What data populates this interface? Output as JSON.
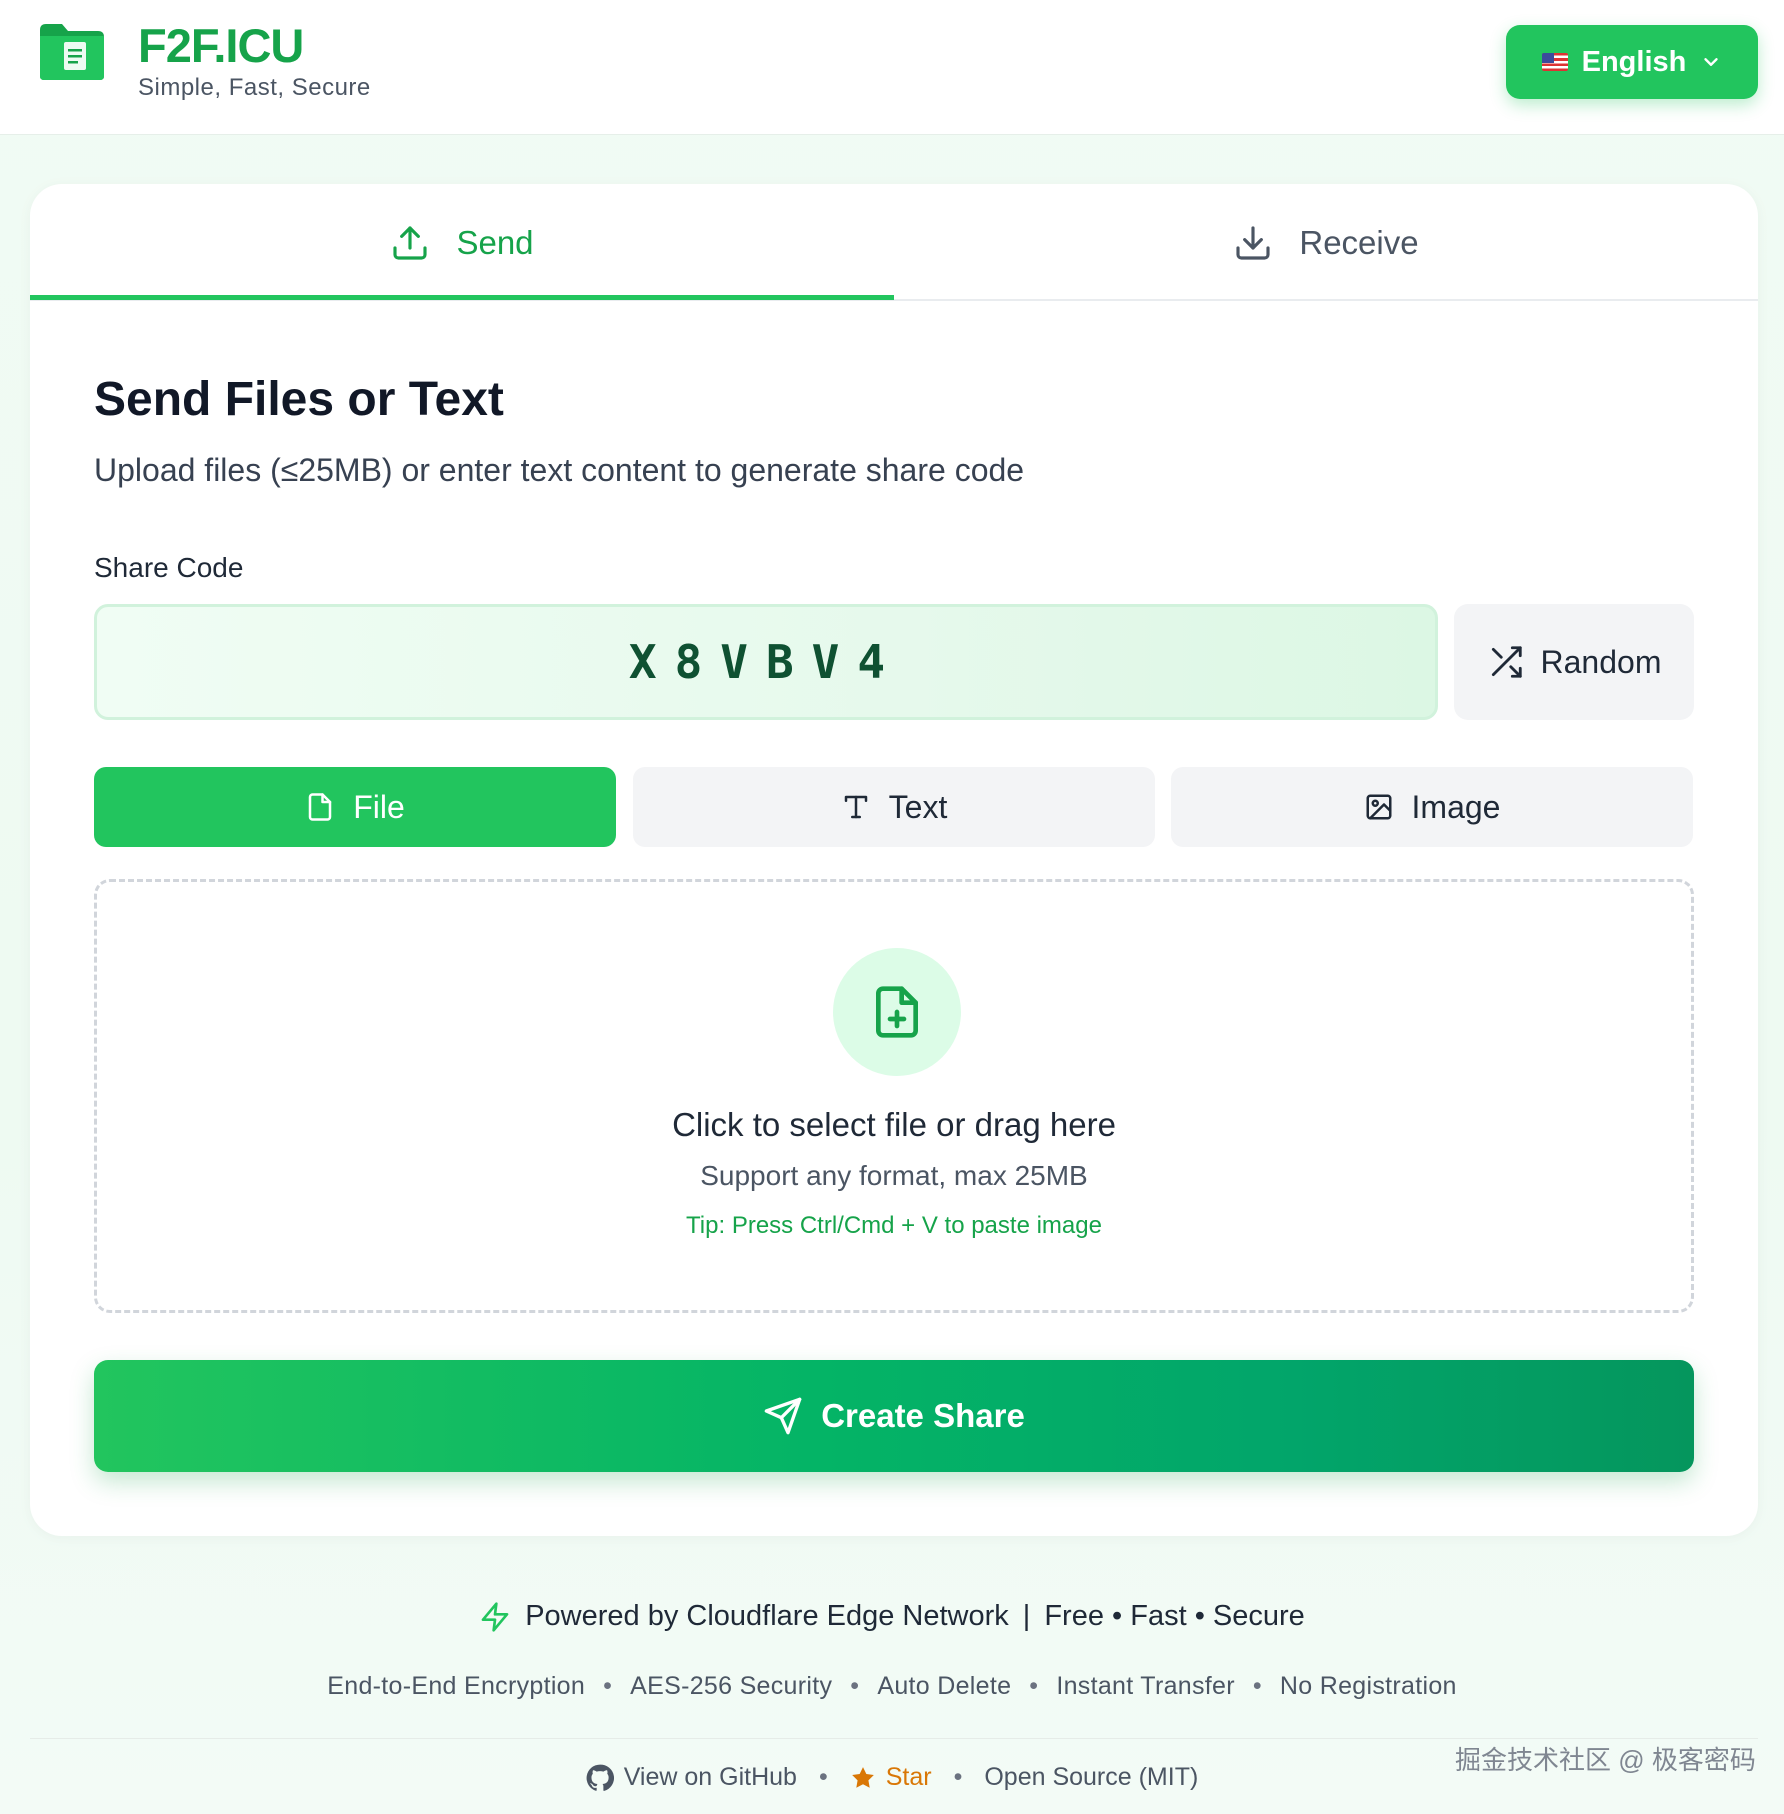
{
  "header": {
    "brand_name": "F2F.ICU",
    "tagline": "Simple, Fast, Secure",
    "language_label": "English",
    "language_flag": "us-flag-icon"
  },
  "tabs": [
    {
      "label": "Send",
      "icon": "upload-icon",
      "active": true
    },
    {
      "label": "Receive",
      "icon": "download-icon",
      "active": false
    }
  ],
  "send": {
    "title": "Send Files or Text",
    "subtitle": "Upload files (≤25MB) or enter text content to generate share code",
    "share_code_label": "Share Code",
    "share_code_value": "X8VBV4",
    "random_label": "Random",
    "modes": [
      {
        "label": "File",
        "icon": "file-icon",
        "active": true
      },
      {
        "label": "Text",
        "icon": "text-icon",
        "active": false
      },
      {
        "label": "Image",
        "icon": "image-icon",
        "active": false
      }
    ],
    "dropzone": {
      "title": "Click to select file or drag here",
      "subtitle": "Support any format, max 25MB",
      "tip": "Tip: Press Ctrl/Cmd + V to paste image"
    },
    "create_label": "Create Share"
  },
  "footer": {
    "powered_by": "Powered by Cloudflare Edge Network",
    "powered_sep": "|",
    "powered_traits": "Free • Fast • Secure",
    "features": [
      "End-to-End Encryption",
      "AES-256 Security",
      "Auto Delete",
      "Instant Transfer",
      "No Registration"
    ],
    "links": {
      "github": "View on GitHub",
      "star": "Star",
      "license": "Open Source (MIT)"
    },
    "watermark": "掘金技术社区 @ 极客密码"
  },
  "colors": {
    "accent": "#22c55e",
    "accent_dark": "#16a34a",
    "star": "#d97706"
  }
}
